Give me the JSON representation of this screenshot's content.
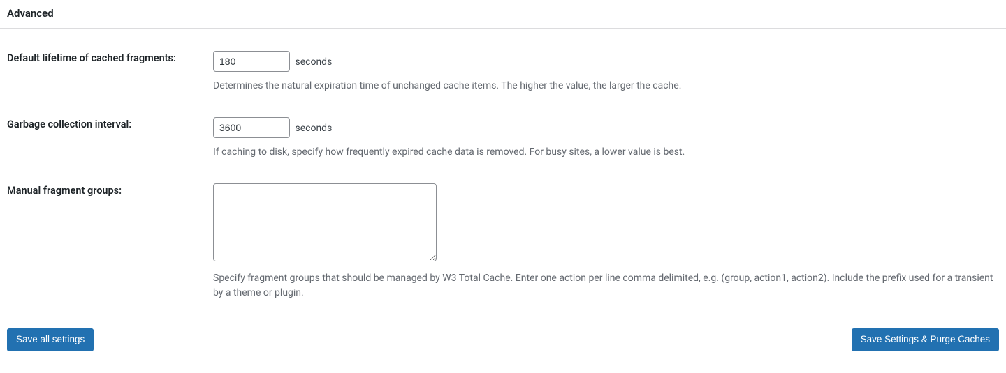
{
  "section": {
    "title": "Advanced"
  },
  "fields": {
    "lifetime": {
      "label": "Default lifetime of cached fragments:",
      "value": "180",
      "unit": "seconds",
      "description": "Determines the natural expiration time of unchanged cache items. The higher the value, the larger the cache."
    },
    "gc": {
      "label": "Garbage collection interval:",
      "value": "3600",
      "unit": "seconds",
      "description": "If caching to disk, specify how frequently expired cache data is removed. For busy sites, a lower value is best."
    },
    "groups": {
      "label": "Manual fragment groups:",
      "value": "",
      "description": "Specify fragment groups that should be managed by W3 Total Cache. Enter one action per line comma delimited, e.g. (group, action1, action2). Include the prefix used for a transient by a theme or plugin."
    }
  },
  "buttons": {
    "save": "Save all settings",
    "save_purge": "Save Settings & Purge Caches"
  }
}
